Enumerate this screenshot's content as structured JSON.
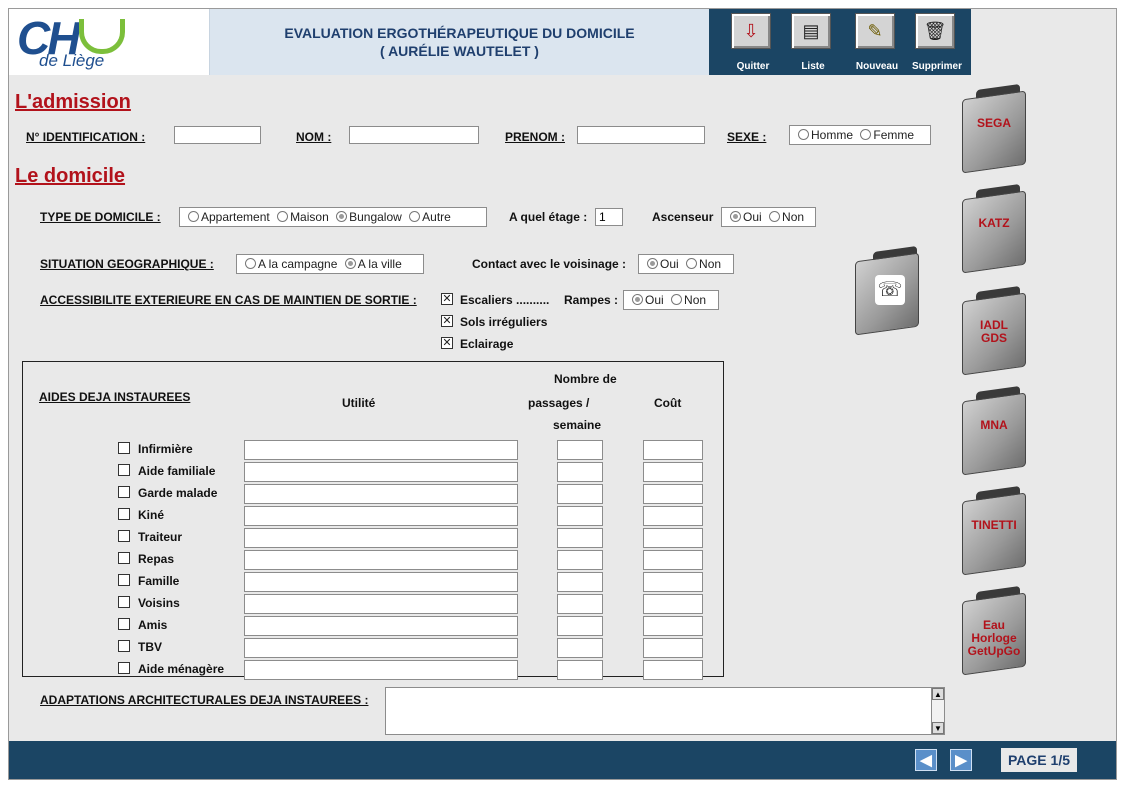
{
  "header": {
    "logo_main": "CH",
    "logo_sub": "de Liège",
    "title_line1": "EVALUATION ERGOTHÉRAPEUTIQUE DU DOMICILE",
    "title_line2": "( AURÉLIE WAUTELET )",
    "toolbar": [
      {
        "label": "Quitter",
        "icon": "exit-icon",
        "glyph": "⇩"
      },
      {
        "label": "Liste",
        "icon": "list-icon",
        "glyph": "▤"
      },
      {
        "label": "Nouveau",
        "icon": "new-document-icon",
        "glyph": "✎"
      },
      {
        "label": "Supprimer",
        "icon": "trash-icon",
        "glyph": "🗑"
      }
    ]
  },
  "admission": {
    "section_title": "L'admission",
    "id_label": "N° IDENTIFICATION :",
    "id_value": "",
    "nom_label": "NOM :",
    "nom_value": "",
    "prenom_label": "PRENOM :",
    "prenom_value": "",
    "sexe_label": "SEXE :",
    "sexe_options": [
      "Homme",
      "Femme"
    ]
  },
  "domicile": {
    "section_title": "Le domicile",
    "type_label": "TYPE DE DOMICILE :",
    "type_options": [
      "Appartement",
      "Maison",
      "Bungalow",
      "Autre"
    ],
    "type_selected": "Bungalow",
    "etage_label": "A quel étage :",
    "etage_value": "1",
    "ascenseur_label": "Ascenseur",
    "ascenseur_options": [
      "Oui",
      "Non"
    ],
    "ascenseur_selected": "Oui",
    "situation_label": "SITUATION GEOGRAPHIQUE :",
    "situation_options": [
      "A la campagne",
      "A la ville"
    ],
    "situation_selected": "A la ville",
    "voisinage_label": "Contact avec le voisinage :",
    "voisinage_options": [
      "Oui",
      "Non"
    ],
    "voisinage_selected": "Oui",
    "access_label": "ACCESSIBILITE EXTERIEURE EN CAS DE MAINTIEN DE SORTIE :",
    "access_items": [
      "Escaliers ..........",
      "Sols irréguliers",
      "Eclairage"
    ],
    "rampes_label": "Rampes :",
    "rampes_options": [
      "Oui",
      "Non"
    ],
    "rampes_selected": "Oui"
  },
  "aides": {
    "title": "AIDES DEJA INSTAUREES",
    "col_utilite": "Utilité",
    "col_passages_1": "Nombre de",
    "col_passages_2": "passages /",
    "col_passages_3": "semaine",
    "col_cout": "Coût",
    "rows": [
      "Infirmière",
      "Aide familiale",
      "Garde malade",
      "Kiné",
      "Traiteur",
      "Repas",
      "Famille",
      "Voisins",
      "Amis",
      "TBV",
      "Aide ménagère"
    ]
  },
  "adaptations": {
    "label": "ADAPTATIONS ARCHITECTURALES DEJA INSTAUREES :",
    "value": ""
  },
  "folders": [
    {
      "line1": "SEGA",
      "line2": "",
      "line3": ""
    },
    {
      "line1": "KATZ",
      "line2": "",
      "line3": ""
    },
    {
      "line1": "IADL",
      "line2": "GDS",
      "line3": ""
    },
    {
      "line1": "MNA",
      "line2": "",
      "line3": ""
    },
    {
      "line1": "TINETTI",
      "line2": "",
      "line3": ""
    },
    {
      "line1": "Eau",
      "line2": "Horloge",
      "line3": "GetUpGo"
    }
  ],
  "footer": {
    "prev_glyph": "◀",
    "next_glyph": "▶",
    "page_label": "PAGE 1/5"
  },
  "colors": {
    "brand_navy": "#1b4564",
    "section_red": "#b2121b",
    "logo_green": "#7cbf3b",
    "logo_blue": "#1f4f8f"
  }
}
